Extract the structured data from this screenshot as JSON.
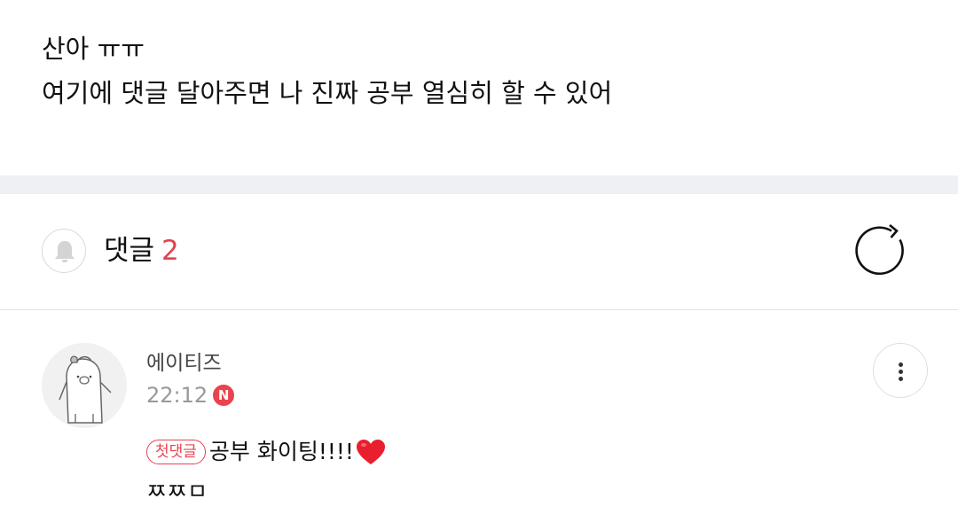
{
  "post": {
    "line1": "산아 ㅠㅠ",
    "line2": "여기에 댓글 달아주면 나 진짜 공부 열심히 할 수 있어"
  },
  "comments_header": {
    "title": "댓글",
    "count": "2",
    "bell_icon": "bell-icon",
    "refresh_icon": "refresh-icon"
  },
  "comments": [
    {
      "author": "에이티즈",
      "time": "22:12",
      "new_badge": "N",
      "first_badge": "첫댓글",
      "line1": "공부 화이팅!!!!",
      "line2": "ㅉㅉㅁ",
      "heart_icon": "heart-icon",
      "avatar_icon": "bear-character-avatar",
      "more_icon": "more-vertical-icon"
    }
  ],
  "colors": {
    "accent": "#e8434e",
    "divider": "#eef0f3",
    "muted": "#999999"
  }
}
